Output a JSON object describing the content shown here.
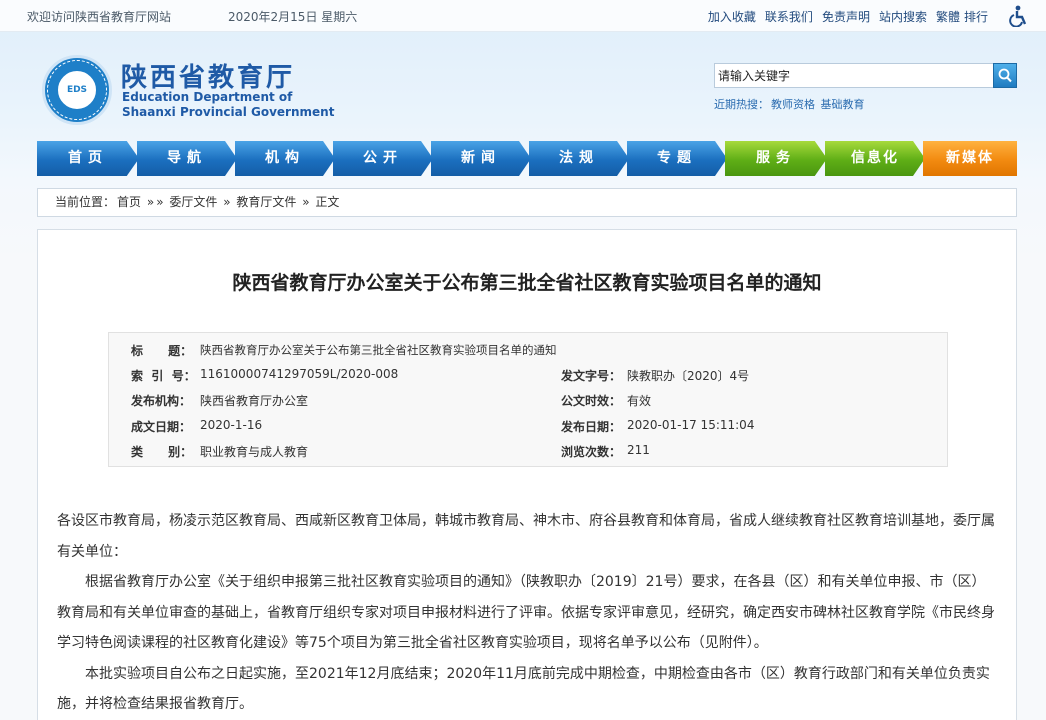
{
  "topbar": {
    "welcome": "欢迎访问陕西省教育厅网站",
    "date": "2020年2月15日 星期六",
    "links": [
      "加入收藏",
      "联系我们",
      "免责声明",
      "站内搜索",
      "繁體",
      "排行"
    ]
  },
  "header": {
    "logo_text": "EDS",
    "title_cn": "陕西省教育厅",
    "title_en_1": "Education Department of",
    "title_en_2": "Shaanxi Provincial Government",
    "search_value": "请输入关键字",
    "hot_label": "近期热搜：",
    "hot_items": [
      "教师资格",
      "基础教育"
    ]
  },
  "nav": [
    "首页",
    "导航",
    "机构",
    "公开",
    "新闻",
    "法规",
    "专题",
    "服务",
    "信息化",
    "新媒体"
  ],
  "breadcrumb": {
    "label": "当前位置：",
    "items": [
      "首页",
      "»",
      "»",
      "委厅文件",
      "»",
      "教育厅文件",
      "»",
      "正文"
    ]
  },
  "article": {
    "title": "陕西省教育厅办公室关于公布第三批全省社区教育实验项目名单的通知",
    "info": {
      "k_title": "标      题：",
      "v_title": "陕西省教育厅办公室关于公布第三批全省社区教育实验项目名单的通知",
      "k_index": "索  引  号：",
      "v_index": "11610000741297059L/2020-008",
      "k_docno": "发文字号：",
      "v_docno": "陕教职办〔2020〕4号",
      "k_org": "发布机构：",
      "v_org": "陕西省教育厅办公室",
      "k_valid": "公文时效：",
      "v_valid": "有效",
      "k_created": "成文日期：",
      "v_created": "2020-1-16",
      "k_published": "发布日期：",
      "v_published": "2020-01-17 15:11:04",
      "k_category": "类      别：",
      "v_category": "职业教育与成人教育",
      "k_views": "浏览次数：",
      "v_views": "211"
    },
    "paragraphs": [
      "各设区市教育局，杨凌示范区教育局、西咸新区教育卫体局，韩城市教育局、神木市、府谷县教育和体育局，省成人继续教育社区教育培训基地，委厅属有关单位：",
      "根据省教育厅办公室《关于组织申报第三批社区教育实验项目的通知》（陕教职办〔2019〕21号）要求，在各县（区）和有关单位申报、市（区）教育局和有关单位审查的基础上，省教育厅组织专家对项目申报材料进行了评审。依据专家评审意见，经研究，确定西安市碑林社区教育学院《市民终身学习特色阅读课程的社区教育化建设》等75个项目为第三批全省社区教育实验项目，现将名单予以公布（见附件）。",
      "本批实验项目自公布之日起实施，至2021年12月底结束；2020年11月底前完成中期检查，中期检查由各市（区）教育行政部门和有关单位负责实施，并将检查结果报省教育厅。"
    ]
  }
}
